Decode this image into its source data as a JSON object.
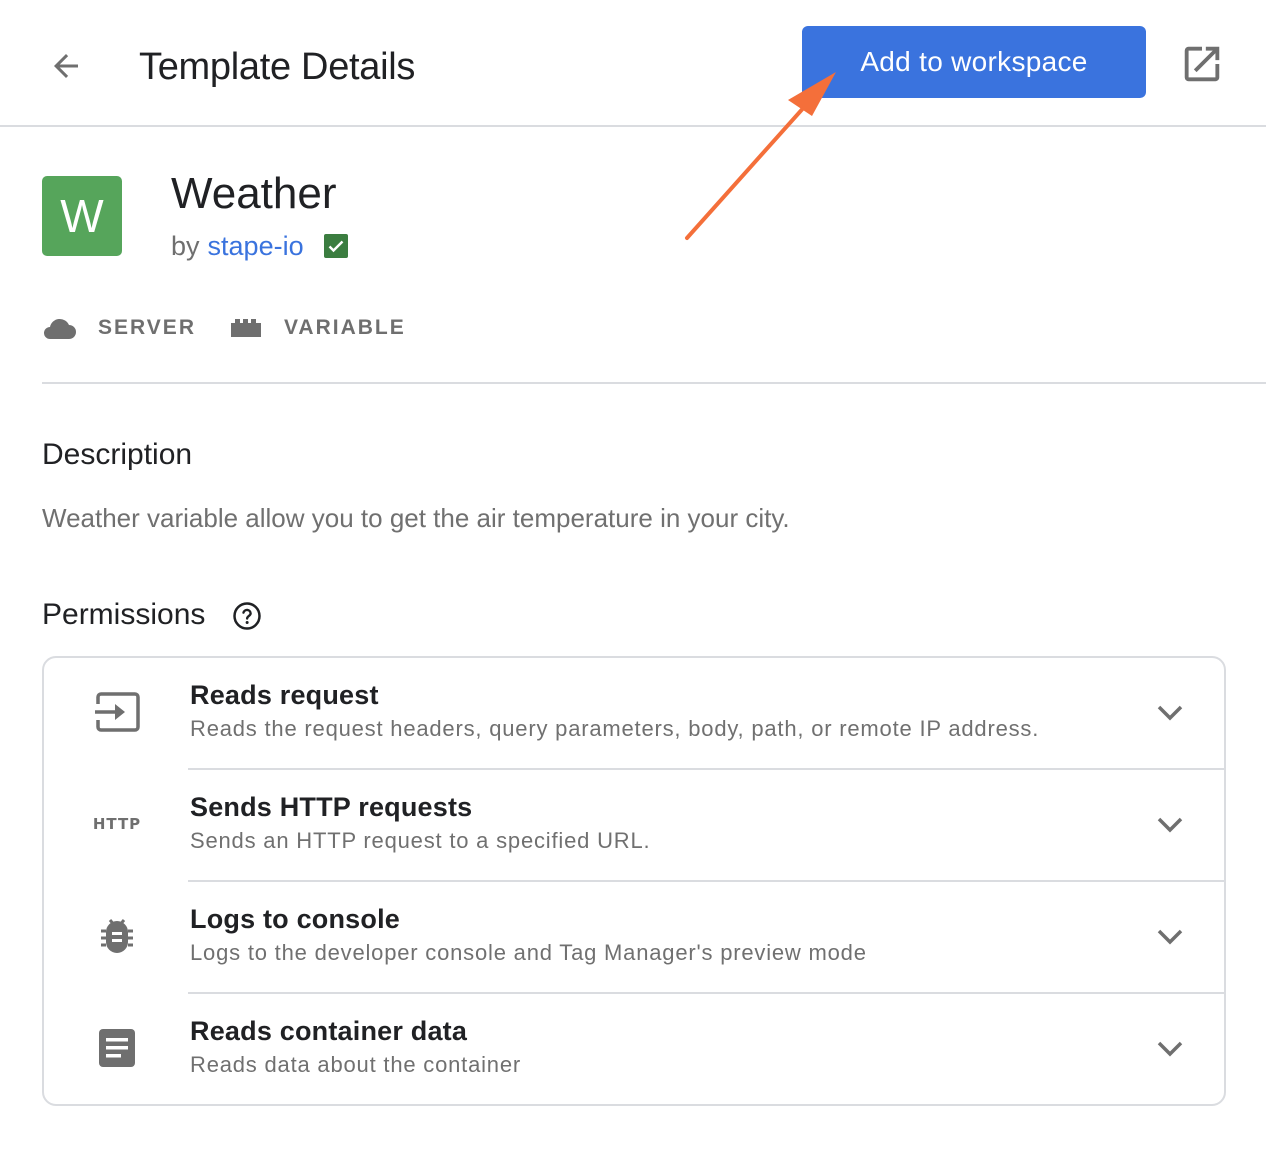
{
  "header": {
    "back_icon": "arrow-left-icon",
    "title": "Template Details",
    "add_button_label": "Add to workspace",
    "open_icon": "open-in-new-icon"
  },
  "template": {
    "logo_letter": "W",
    "name": "Weather",
    "by_label": "by",
    "author": "stape-io",
    "verified_icon": "verified-check-icon",
    "tags": [
      {
        "icon": "cloud-icon",
        "label": "SERVER"
      },
      {
        "icon": "brick-icon",
        "label": "VARIABLE"
      }
    ]
  },
  "description": {
    "title": "Description",
    "text": "Weather variable allow you to get the air temperature in your city."
  },
  "permissions": {
    "title": "Permissions",
    "help_icon": "help-circle-icon",
    "items": [
      {
        "icon": "input-icon",
        "title": "Reads request",
        "desc": "Reads the request headers, query parameters, body, path, or remote IP address."
      },
      {
        "icon": "http-icon",
        "icon_text": "HTTP",
        "title": "Sends HTTP requests",
        "desc": "Sends an HTTP request to a specified URL."
      },
      {
        "icon": "bug-icon",
        "title": "Logs to console",
        "desc": "Logs to the developer console and Tag Manager's preview mode"
      },
      {
        "icon": "document-icon",
        "title": "Reads container data",
        "desc": "Reads data about the container"
      }
    ]
  },
  "colors": {
    "accent": "#3a73de",
    "logo_bg": "#56a55b",
    "verified": "#3b7d40",
    "annotation_arrow": "#f46f3a"
  }
}
